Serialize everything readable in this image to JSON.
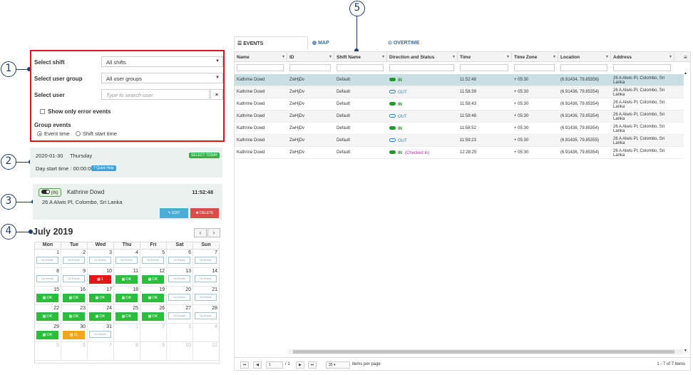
{
  "callouts": [
    "1",
    "2",
    "3",
    "4",
    "5"
  ],
  "filters": {
    "select_shift_label": "Select shift",
    "select_shift_value": "All shifts",
    "user_group_label": "Select user group",
    "user_group_value": "All user groups",
    "select_user_label": "Select user",
    "select_user_placeholder": "Type to search user",
    "error_only_label": "Show only error events",
    "group_events_label": "Group events",
    "group_option_1": "Event time",
    "group_option_2": "Shift start time"
  },
  "date_panel": {
    "date": "2020-01-30",
    "weekday": "Thursday",
    "select_today": "SELECT TODAY",
    "day_start": "Day start time : 00:00:00",
    "quick_help": "Quick Help"
  },
  "user_panel": {
    "status": "(IN)",
    "name": "Kathrine Dowd",
    "time": "11:52:48",
    "address": "26 A Alwis Pl, Colombo, Sri Lanka",
    "edit": "EDIT",
    "delete": "DELETE"
  },
  "calendar": {
    "month": "July 2019",
    "days": [
      "Mon",
      "Tue",
      "Wed",
      "Thu",
      "Fri",
      "Sat",
      "Sun"
    ],
    "no_events": "No Events",
    "ok": "OK",
    "weeks": [
      [
        [
          "1",
          "ne"
        ],
        [
          "2",
          "ne"
        ],
        [
          "3",
          "ne"
        ],
        [
          "4",
          "ne"
        ],
        [
          "5",
          "ne"
        ],
        [
          "6",
          "ne"
        ],
        [
          "7",
          "ne"
        ]
      ],
      [
        [
          "8",
          "ne"
        ],
        [
          "9",
          "ne"
        ],
        [
          "10",
          "red",
          "1"
        ],
        [
          "11",
          "ok"
        ],
        [
          "12",
          "ok"
        ],
        [
          "13",
          "ne"
        ],
        [
          "14",
          "ne"
        ]
      ],
      [
        [
          "15",
          "ok"
        ],
        [
          "16",
          "ok"
        ],
        [
          "17",
          "ok"
        ],
        [
          "18",
          "ok"
        ],
        [
          "19",
          "ok"
        ],
        [
          "20",
          "ne"
        ],
        [
          "21",
          "ne"
        ]
      ],
      [
        [
          "22",
          "ok"
        ],
        [
          "23",
          "ok"
        ],
        [
          "24",
          "ok"
        ],
        [
          "25",
          "ok"
        ],
        [
          "26",
          "ok"
        ],
        [
          "27",
          "ne"
        ],
        [
          "28",
          "ne"
        ]
      ],
      [
        [
          "29",
          "ok"
        ],
        [
          "30",
          "org",
          "11"
        ],
        [
          "31",
          "ne"
        ],
        [
          "1",
          "oth"
        ],
        [
          "2",
          "oth"
        ],
        [
          "3",
          "oth"
        ],
        [
          "4",
          "oth"
        ]
      ],
      [
        [
          "5",
          "oth"
        ],
        [
          "6",
          "oth"
        ],
        [
          "7",
          "oth"
        ],
        [
          "8",
          "oth"
        ],
        [
          "9",
          "oth"
        ],
        [
          "10",
          "oth"
        ],
        [
          "11",
          "oth"
        ]
      ]
    ]
  },
  "tabs": {
    "events": "EVENTS",
    "map": "MAP",
    "overtime": "OVERTIME"
  },
  "grid": {
    "columns": [
      "Name",
      "ID",
      "Shift Name",
      "Direction and Status",
      "Time",
      "Time Zone",
      "Location",
      "Address"
    ],
    "rows": [
      [
        "Kathrine Dowd",
        "ZwHjDv",
        "Default",
        "IN",
        "11:52:48",
        "+ 05:30",
        "(6.91434, 79.85356)",
        "26 A Alwis Pl, Colombo, Sri Lanka"
      ],
      [
        "Kathrine Dowd",
        "ZwHjDv",
        "Default",
        "OUT",
        "11:58:39",
        "+ 05:30",
        "(6.91436, 79.85354)",
        "26 A Alwis Pl, Colombo, Sri Lanka"
      ],
      [
        "Kathrine Dowd",
        "ZwHjDv",
        "Default",
        "IN",
        "11:58:43",
        "+ 05:30",
        "(6.91436, 79.85354)",
        "26 A Alwis Pl, Colombo, Sri Lanka"
      ],
      [
        "Kathrine Dowd",
        "ZwHjDv",
        "Default",
        "OUT",
        "11:58:48",
        "+ 05:30",
        "(6.91436, 79.85354)",
        "26 A Alwis Pl, Colombo, Sri Lanka"
      ],
      [
        "Kathrine Dowd",
        "ZwHjDv",
        "Default",
        "IN",
        "11:58:52",
        "+ 05:30",
        "(6.91436, 79.85354)",
        "26 A Alwis Pl, Colombo, Sri Lanka"
      ],
      [
        "Kathrine Dowd",
        "ZwHjDv",
        "Default",
        "OUT",
        "11:59:23",
        "+ 05:30",
        "(6.91435, 79.85355)",
        "26 A Alwis Pl, Colombo, Sri Lanka"
      ],
      [
        "Kathrine Dowd",
        "ZwHjDv",
        "Default",
        "IN",
        "12:28:25",
        "+ 05:30",
        "(6.91436, 79.85354)",
        "26 A Alwis Pl, Colombo, Sri Lanka"
      ]
    ],
    "checked_in": "(Checked In)",
    "pager": {
      "page": "1",
      "of": "/ 1",
      "page_size": "35",
      "per_page": "items per page",
      "summary": "1 - 7 of 7 items"
    }
  }
}
